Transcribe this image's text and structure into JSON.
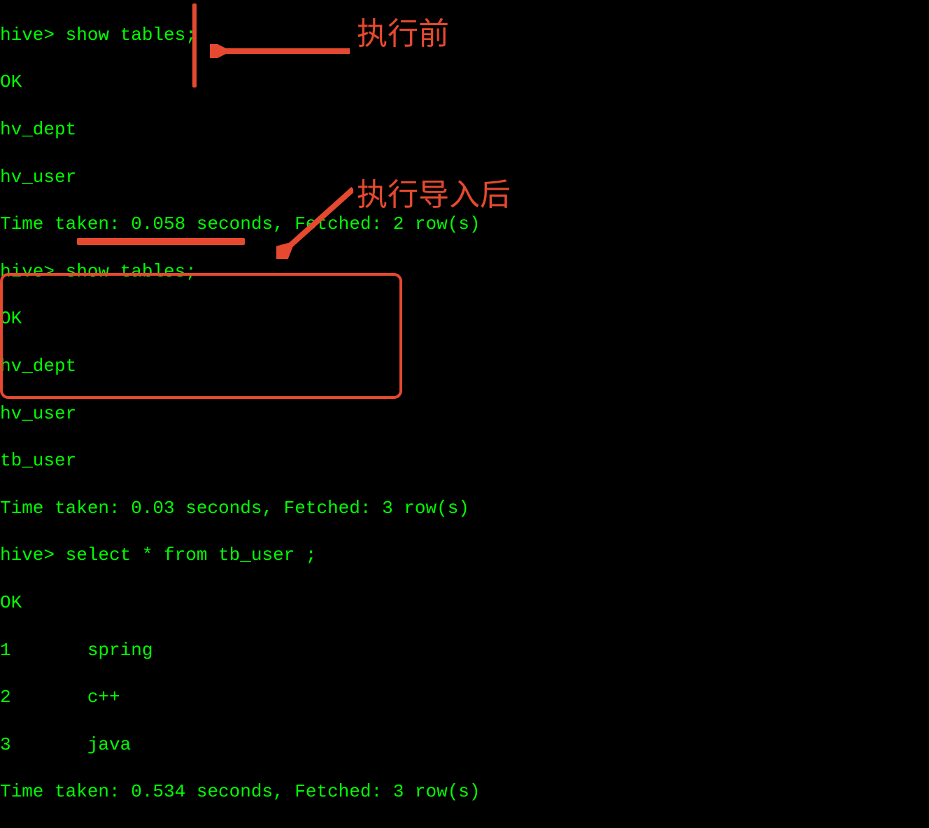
{
  "terminal": {
    "line1": "hive> show tables;",
    "line2": "OK",
    "line3": "hv_dept",
    "line4": "hv_user",
    "line5": "Time taken: 0.058 seconds, Fetched: 2 row(s)",
    "line6": "hive> show tables;",
    "line7": "OK",
    "line8": "hv_dept",
    "line9": "hv_user",
    "line10": "tb_user",
    "line11": "Time taken: 0.03 seconds, Fetched: 3 row(s)",
    "line12": "hive> select * from tb_user ;",
    "line13": "OK",
    "line14": "1       spring",
    "line15": "2       c++",
    "line16": "3       java",
    "line17": "Time taken: 0.534 seconds, Fetched: 3 row(s)"
  },
  "annotations": {
    "before": "执行前",
    "after": "执行导入后"
  }
}
